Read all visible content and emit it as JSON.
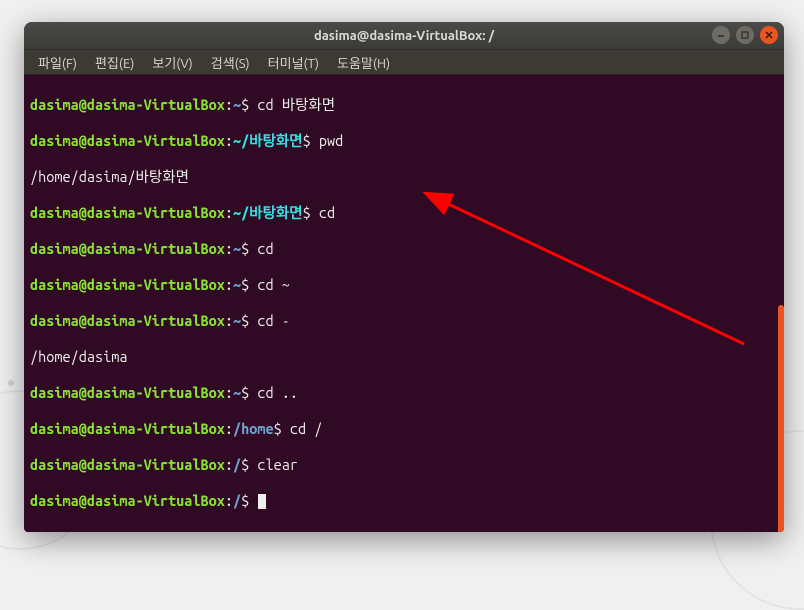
{
  "window": {
    "title": "dasima@dasima-VirtualBox: /"
  },
  "menu": {
    "file": "파일(F)",
    "edit": "편집(E)",
    "view": "보기(V)",
    "search": "검색(S)",
    "terminal": "터미널(T)",
    "help": "도움말(H)"
  },
  "prompt": {
    "userhost": "dasima@dasima-VirtualBox",
    "sep": ":",
    "dollar": "$"
  },
  "paths": {
    "home": "~",
    "desktop": "~/바탕화면",
    "hometxt": "/home",
    "root": "/"
  },
  "cmds": {
    "cd_desktop": " cd 바탕화면",
    "pwd": " pwd",
    "cd": " cd",
    "cd_tilde": " cd ~",
    "cd_dash": " cd -",
    "cd_dotdot": " cd ..",
    "cd_slash": " cd /",
    "clear": " clear",
    "empty": " "
  },
  "output": {
    "pwd_desktop": "/home/dasima/바탕화면",
    "home_dir": "/home/dasima"
  }
}
